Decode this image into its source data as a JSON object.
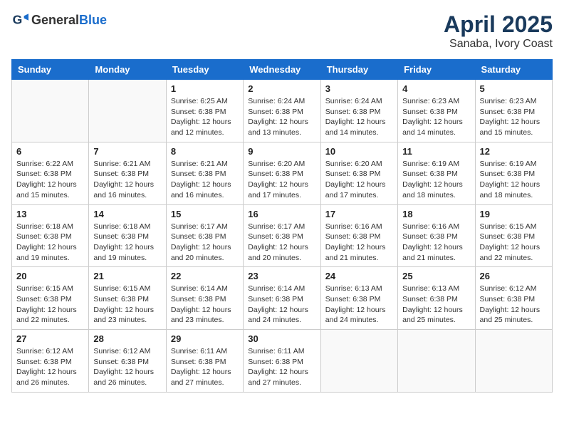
{
  "header": {
    "logo_general": "General",
    "logo_blue": "Blue",
    "month_year": "April 2025",
    "location": "Sanaba, Ivory Coast"
  },
  "weekdays": [
    "Sunday",
    "Monday",
    "Tuesday",
    "Wednesday",
    "Thursday",
    "Friday",
    "Saturday"
  ],
  "weeks": [
    [
      {
        "day": "",
        "info": ""
      },
      {
        "day": "",
        "info": ""
      },
      {
        "day": "1",
        "info": "Sunrise: 6:25 AM\nSunset: 6:38 PM\nDaylight: 12 hours and 12 minutes."
      },
      {
        "day": "2",
        "info": "Sunrise: 6:24 AM\nSunset: 6:38 PM\nDaylight: 12 hours and 13 minutes."
      },
      {
        "day": "3",
        "info": "Sunrise: 6:24 AM\nSunset: 6:38 PM\nDaylight: 12 hours and 14 minutes."
      },
      {
        "day": "4",
        "info": "Sunrise: 6:23 AM\nSunset: 6:38 PM\nDaylight: 12 hours and 14 minutes."
      },
      {
        "day": "5",
        "info": "Sunrise: 6:23 AM\nSunset: 6:38 PM\nDaylight: 12 hours and 15 minutes."
      }
    ],
    [
      {
        "day": "6",
        "info": "Sunrise: 6:22 AM\nSunset: 6:38 PM\nDaylight: 12 hours and 15 minutes."
      },
      {
        "day": "7",
        "info": "Sunrise: 6:21 AM\nSunset: 6:38 PM\nDaylight: 12 hours and 16 minutes."
      },
      {
        "day": "8",
        "info": "Sunrise: 6:21 AM\nSunset: 6:38 PM\nDaylight: 12 hours and 16 minutes."
      },
      {
        "day": "9",
        "info": "Sunrise: 6:20 AM\nSunset: 6:38 PM\nDaylight: 12 hours and 17 minutes."
      },
      {
        "day": "10",
        "info": "Sunrise: 6:20 AM\nSunset: 6:38 PM\nDaylight: 12 hours and 17 minutes."
      },
      {
        "day": "11",
        "info": "Sunrise: 6:19 AM\nSunset: 6:38 PM\nDaylight: 12 hours and 18 minutes."
      },
      {
        "day": "12",
        "info": "Sunrise: 6:19 AM\nSunset: 6:38 PM\nDaylight: 12 hours and 18 minutes."
      }
    ],
    [
      {
        "day": "13",
        "info": "Sunrise: 6:18 AM\nSunset: 6:38 PM\nDaylight: 12 hours and 19 minutes."
      },
      {
        "day": "14",
        "info": "Sunrise: 6:18 AM\nSunset: 6:38 PM\nDaylight: 12 hours and 19 minutes."
      },
      {
        "day": "15",
        "info": "Sunrise: 6:17 AM\nSunset: 6:38 PM\nDaylight: 12 hours and 20 minutes."
      },
      {
        "day": "16",
        "info": "Sunrise: 6:17 AM\nSunset: 6:38 PM\nDaylight: 12 hours and 20 minutes."
      },
      {
        "day": "17",
        "info": "Sunrise: 6:16 AM\nSunset: 6:38 PM\nDaylight: 12 hours and 21 minutes."
      },
      {
        "day": "18",
        "info": "Sunrise: 6:16 AM\nSunset: 6:38 PM\nDaylight: 12 hours and 21 minutes."
      },
      {
        "day": "19",
        "info": "Sunrise: 6:15 AM\nSunset: 6:38 PM\nDaylight: 12 hours and 22 minutes."
      }
    ],
    [
      {
        "day": "20",
        "info": "Sunrise: 6:15 AM\nSunset: 6:38 PM\nDaylight: 12 hours and 22 minutes."
      },
      {
        "day": "21",
        "info": "Sunrise: 6:15 AM\nSunset: 6:38 PM\nDaylight: 12 hours and 23 minutes."
      },
      {
        "day": "22",
        "info": "Sunrise: 6:14 AM\nSunset: 6:38 PM\nDaylight: 12 hours and 23 minutes."
      },
      {
        "day": "23",
        "info": "Sunrise: 6:14 AM\nSunset: 6:38 PM\nDaylight: 12 hours and 24 minutes."
      },
      {
        "day": "24",
        "info": "Sunrise: 6:13 AM\nSunset: 6:38 PM\nDaylight: 12 hours and 24 minutes."
      },
      {
        "day": "25",
        "info": "Sunrise: 6:13 AM\nSunset: 6:38 PM\nDaylight: 12 hours and 25 minutes."
      },
      {
        "day": "26",
        "info": "Sunrise: 6:12 AM\nSunset: 6:38 PM\nDaylight: 12 hours and 25 minutes."
      }
    ],
    [
      {
        "day": "27",
        "info": "Sunrise: 6:12 AM\nSunset: 6:38 PM\nDaylight: 12 hours and 26 minutes."
      },
      {
        "day": "28",
        "info": "Sunrise: 6:12 AM\nSunset: 6:38 PM\nDaylight: 12 hours and 26 minutes."
      },
      {
        "day": "29",
        "info": "Sunrise: 6:11 AM\nSunset: 6:38 PM\nDaylight: 12 hours and 27 minutes."
      },
      {
        "day": "30",
        "info": "Sunrise: 6:11 AM\nSunset: 6:38 PM\nDaylight: 12 hours and 27 minutes."
      },
      {
        "day": "",
        "info": ""
      },
      {
        "day": "",
        "info": ""
      },
      {
        "day": "",
        "info": ""
      }
    ]
  ]
}
